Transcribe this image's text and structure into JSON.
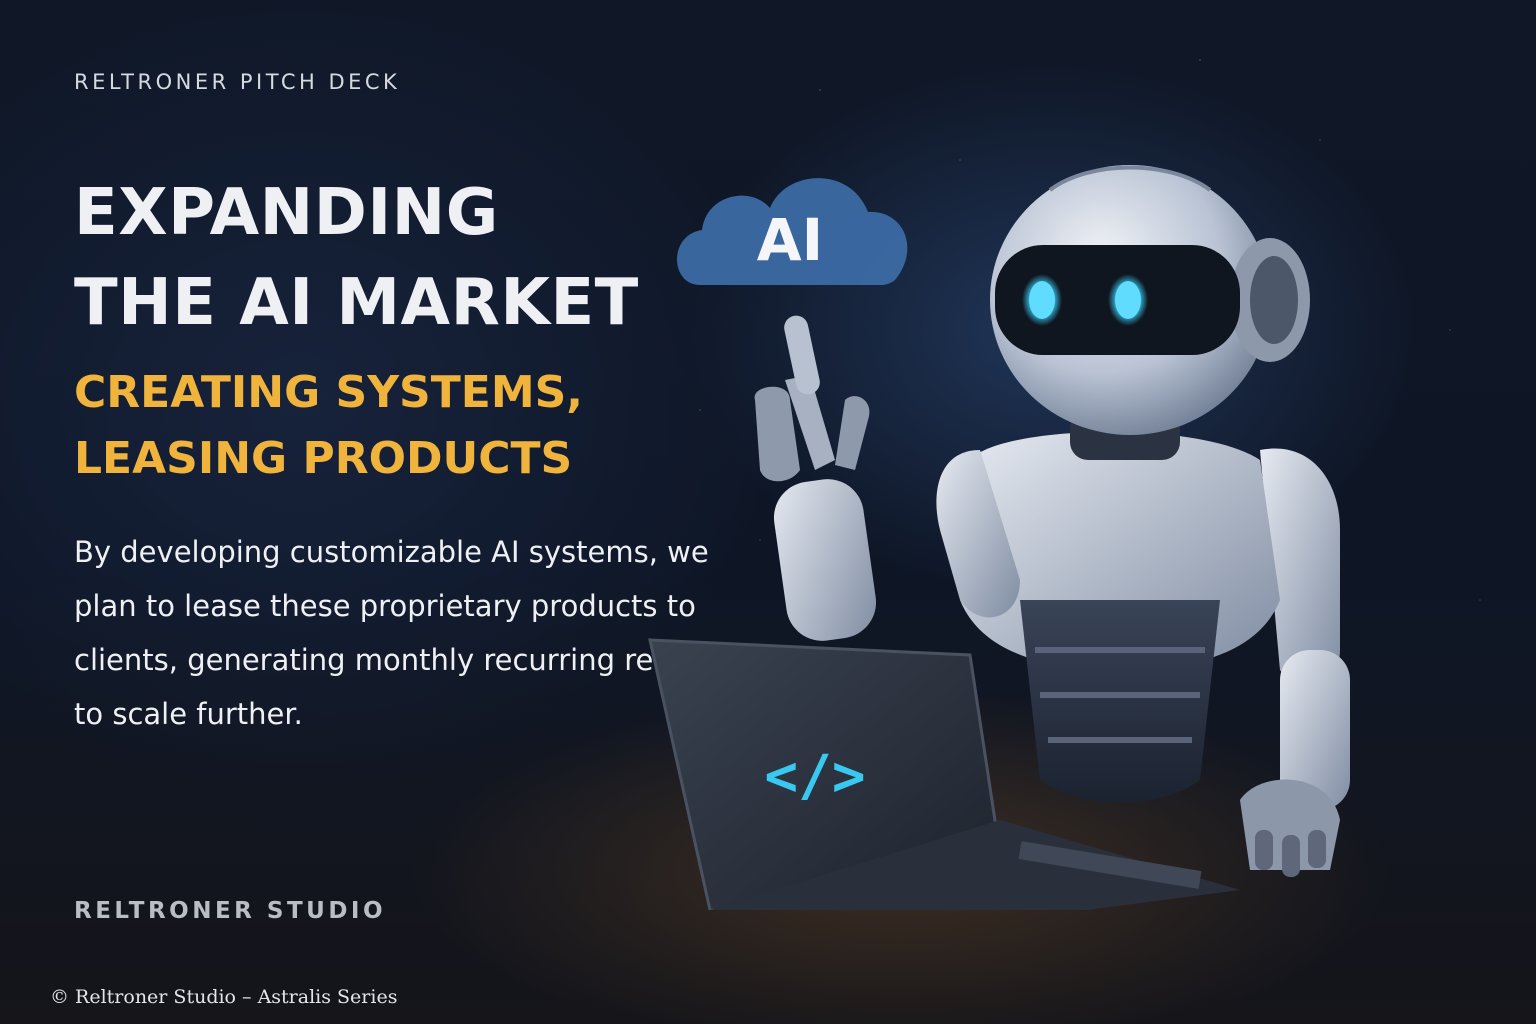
{
  "slide": {
    "eyebrow": "RELTRONER PITCH DECK",
    "headline_lines": [
      "EXPANDING",
      "THE AI MARKET"
    ],
    "subhead_lines": [
      "CREATING SYSTEMS,",
      "LEASING PRODUCTS"
    ],
    "body": "By developing customizable AI systems, we plan to lease these proprietary products to clients, generating monthly recurring revenue to scale further.",
    "studio_label": "RELTRONER STUDIO",
    "copyright": "© Reltroner Studio – Astralis Series"
  },
  "illustration": {
    "cloud_label": "AI",
    "laptop_code_symbol": "</>",
    "icons": [
      "cloud-icon",
      "robot-illustration",
      "laptop-illustration",
      "code-icon"
    ]
  },
  "colors": {
    "background": "#0d1322",
    "headline": "#eef0f3",
    "accent": "#f0b43c",
    "cloud": "#3b6aa3",
    "glow": "#38c8f0"
  }
}
